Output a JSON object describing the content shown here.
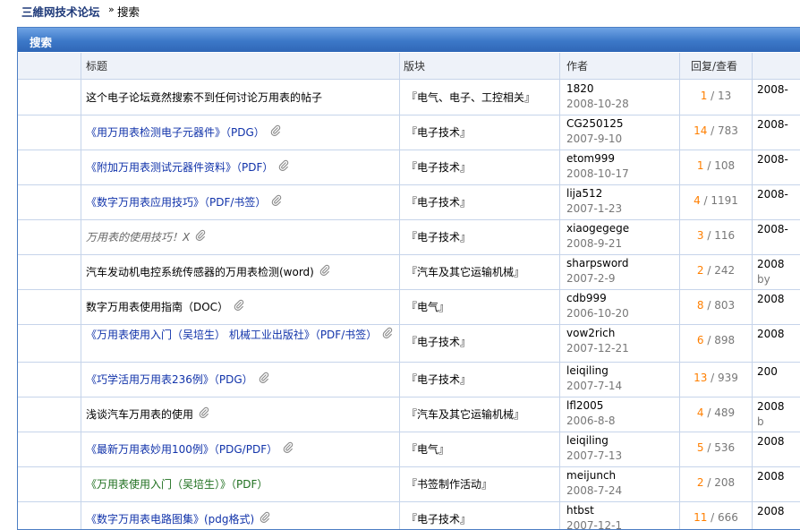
{
  "nav": {
    "home": "三維网技术论坛",
    "sep": "»",
    "current": "搜索"
  },
  "panel": {
    "title": "搜索"
  },
  "headers": {
    "title": "标题",
    "forum": "版块",
    "author": "作者",
    "replies": "回复/查看"
  },
  "rows": [
    {
      "title": "这个电子论坛竟然搜索不到任何讨论万用表的帖子",
      "style": "black",
      "attach": false,
      "forum": "『电气、电子、工控相关』",
      "author": "1820",
      "date": "2008-10-28",
      "replies": "1",
      "views": "13",
      "last": "2008-",
      "last_by": ""
    },
    {
      "title": "《用万用表检测电子元器件》（PDG）",
      "style": "blue",
      "attach": true,
      "forum": "『电子技术』",
      "author": "CG250125",
      "date": "2007-9-10",
      "replies": "14",
      "views": "783",
      "last": "2008-",
      "last_by": ""
    },
    {
      "title": "《附加万用表测试元器件资料》（PDF）",
      "style": "blue",
      "attach": true,
      "forum": "『电子技术』",
      "author": "etom999",
      "date": "2008-10-17",
      "replies": "1",
      "views": "108",
      "last": "2008-",
      "last_by": ""
    },
    {
      "title": "《数字万用表应用技巧》（PDF/书签）",
      "style": "blue",
      "attach": true,
      "forum": "『电子技术』",
      "author": "lija512",
      "date": "2007-1-23",
      "replies": "4",
      "views": "1191",
      "last": "2008-",
      "last_by": ""
    },
    {
      "title": "万用表的使用技巧！X",
      "style": "grey",
      "attach": true,
      "forum": "『电子技术』",
      "author": "xiaogegege",
      "date": "2008-9-21",
      "replies": "3",
      "views": "116",
      "last": "2008-",
      "last_by": ""
    },
    {
      "title": "汽车发动机电控系统传感器的万用表检测(word)",
      "style": "black",
      "attach": true,
      "forum": "『汽车及其它运输机械』",
      "author": "sharpsword",
      "date": "2007-2-9",
      "replies": "2",
      "views": "242",
      "last": "2008",
      "last_by": "by"
    },
    {
      "title": "数字万用表使用指南（DOC）",
      "style": "black",
      "attach": true,
      "forum": "『电气』",
      "author": "cdb999",
      "date": "2006-10-20",
      "replies": "8",
      "views": "803",
      "last": "2008",
      "last_by": ""
    },
    {
      "title": "《万用表使用入门（吴培生） 机械工业出版社》（PDF/书签）",
      "style": "blue",
      "attach": true,
      "two_line": true,
      "forum": "『电子技术』",
      "author": "vow2rich",
      "date": "2007-12-21",
      "replies": "6",
      "views": "898",
      "last": "2008",
      "last_by": ""
    },
    {
      "title": "《巧学活用万用表236例》（PDG）",
      "style": "blue",
      "attach": true,
      "forum": "『电子技术』",
      "author": "leiqiling",
      "date": "2007-7-14",
      "replies": "13",
      "views": "939",
      "last": "200",
      "last_by": ""
    },
    {
      "title": "浅谈汽车万用表的使用",
      "style": "black",
      "attach": true,
      "forum": "『汽车及其它运输机械』",
      "author": "lfl2005",
      "date": "2006-8-8",
      "replies": "4",
      "views": "489",
      "last": "2008",
      "last_by": "b"
    },
    {
      "title": "《最新万用表妙用100例》（PDG/PDF）",
      "style": "blue",
      "attach": true,
      "forum": "『电气』",
      "author": "leiqiling",
      "date": "2007-7-13",
      "replies": "5",
      "views": "536",
      "last": "2008",
      "last_by": ""
    },
    {
      "title": "《万用表使用入门（吴培生）》（PDF）",
      "style": "green",
      "attach": false,
      "forum": "『书签制作活动』",
      "author": "meijunch",
      "date": "2008-7-24",
      "replies": "2",
      "views": "208",
      "last": "2008",
      "last_by": ""
    },
    {
      "title": "《数字万用表电路图集》(pdg格式)",
      "style": "blue",
      "attach": true,
      "forum": "『电子技术』",
      "author": "htbst",
      "date": "2007-12-1",
      "replies": "11",
      "views": "666",
      "last": "2008",
      "last_by": ""
    }
  ],
  "icons": {
    "attachment": "paperclip-icon"
  },
  "colors": {
    "header_bar": "#3c78c8",
    "reply_count": "#ff7f00",
    "link": "#1133aa",
    "grid": "#c6d4ea"
  }
}
